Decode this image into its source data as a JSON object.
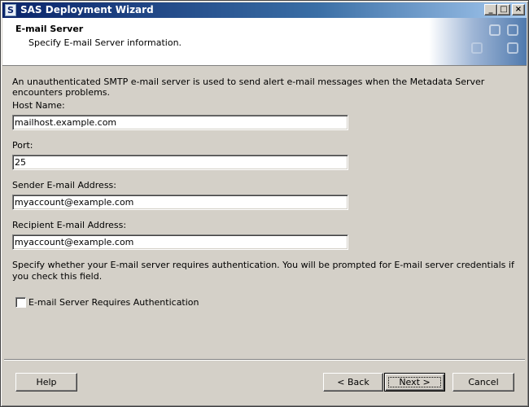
{
  "window": {
    "title": "SAS Deployment Wizard",
    "app_icon_glyph": "S",
    "controls": {
      "minimize": "_",
      "maximize": "□",
      "close": "×"
    }
  },
  "header": {
    "title": "E-mail Server",
    "subtitle": "Specify E-mail Server information."
  },
  "intro_text": "An unauthenticated SMTP e-mail server is used to send alert e-mail messages when the Metadata Server encounters problems.",
  "fields": {
    "host": {
      "label": "Host Name:",
      "value": "mailhost.example.com"
    },
    "port": {
      "label": "Port:",
      "value": "25"
    },
    "sender": {
      "label": "Sender E-mail Address:",
      "value": "myaccount@example.com"
    },
    "recipient": {
      "label": "Recipient E-mail Address:",
      "value": "myaccount@example.com"
    }
  },
  "auth": {
    "description": "Specify whether your E-mail server requires authentication. You will be prompted for E-mail server credentials if you check this field.",
    "checkbox_label": "E-mail Server Requires Authentication",
    "checked": false
  },
  "buttons": {
    "help": "Help",
    "back": "< Back",
    "next": "Next >",
    "cancel": "Cancel"
  },
  "colors": {
    "title_bar": "#0a246a",
    "dialog_bg": "#d4d0c8",
    "header_bg": "#ffffff"
  }
}
